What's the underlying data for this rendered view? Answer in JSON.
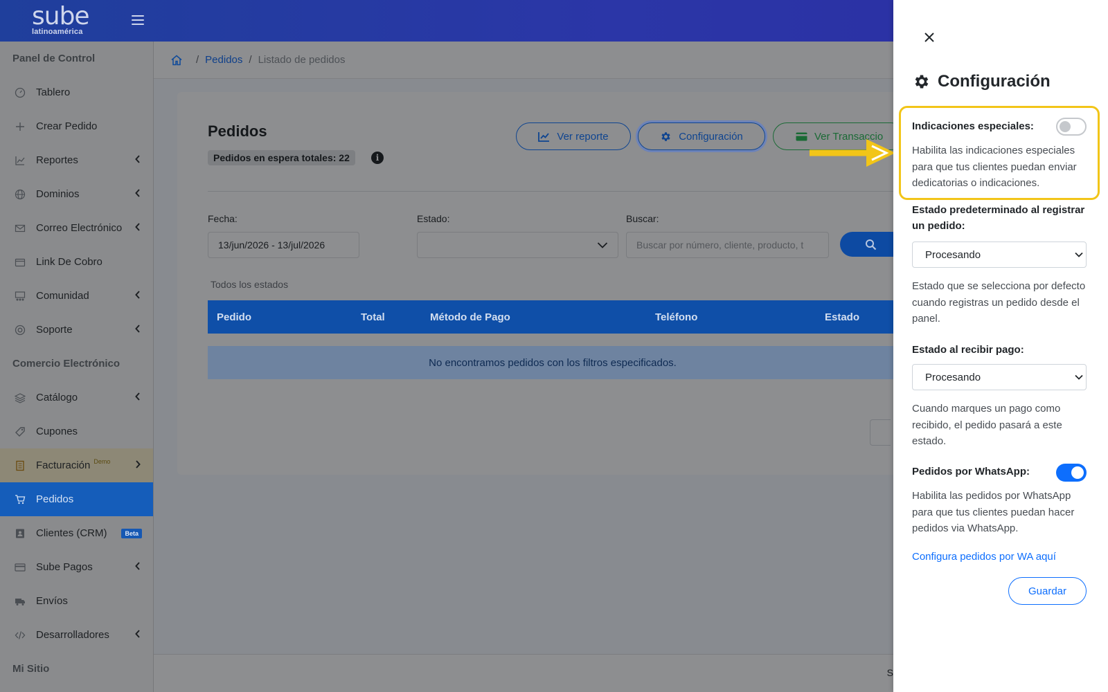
{
  "brand": {
    "logo_main": "sube",
    "logo_sub": "latinoamérica"
  },
  "colors": {
    "highlight": "#f2c518",
    "panel_accent": "#0d6efd",
    "active_nav": "#155dba"
  },
  "sidebar": {
    "sections": [
      {
        "title": "Panel de Control"
      },
      {
        "title": "Comercio Electrónico"
      },
      {
        "title": "Mi Sitio"
      }
    ],
    "control_items": [
      {
        "label": "Tablero",
        "icon": "gauge-icon",
        "has_submenu": false
      },
      {
        "label": "Crear Pedido",
        "icon": "plus-icon",
        "has_submenu": false
      },
      {
        "label": "Reportes",
        "icon": "chart-line-icon",
        "has_submenu": true
      },
      {
        "label": "Dominios",
        "icon": "globe-icon",
        "has_submenu": true
      },
      {
        "label": "Correo Electrónico",
        "icon": "envelope-icon",
        "has_submenu": true
      },
      {
        "label": "Link De Cobro",
        "icon": "wallet-icon",
        "has_submenu": false
      },
      {
        "label": "Comunidad",
        "icon": "community-icon",
        "has_submenu": true
      },
      {
        "label": "Soporte",
        "icon": "lifebuoy-icon",
        "has_submenu": true
      }
    ],
    "commerce_items": [
      {
        "label": "Catálogo",
        "icon": "layers-icon",
        "has_submenu": true
      },
      {
        "label": "Cupones",
        "icon": "tag-icon",
        "has_submenu": false
      },
      {
        "label": "Facturación",
        "sup": "Demo",
        "icon": "receipt-icon",
        "has_submenu": true
      },
      {
        "label": "Pedidos",
        "icon": "cart-icon",
        "active": true
      },
      {
        "label": "Clientes (CRM)",
        "badge": "Beta",
        "icon": "contact-icon"
      },
      {
        "label": "Sube Pagos",
        "icon": "card-icon",
        "has_submenu": true
      },
      {
        "label": "Envíos",
        "icon": "truck-icon",
        "has_submenu": false
      },
      {
        "label": "Desarrolladores",
        "icon": "code-icon",
        "has_submenu": true
      }
    ]
  },
  "breadcrumb": {
    "link": "Pedidos",
    "current": "Listado de pedidos",
    "separator": "/"
  },
  "orders": {
    "title": "Pedidos",
    "badge": "Pedidos en espera totales: 22",
    "buttons": {
      "report": "Ver reporte",
      "config": "Configuración",
      "transactions": "Ver Transaccio"
    },
    "filters": {
      "date_label": "Fecha:",
      "date_value": "13/jun/2026 - 13/jul/2026",
      "state_label": "Estado:",
      "state_value": "",
      "search_label": "Buscar:",
      "search_placeholder": "Buscar por número, cliente, producto, t"
    },
    "all_states": "Todos los estados",
    "columns": [
      "Pedido",
      "Total",
      "Método de Pago",
      "Teléfono",
      "Estado"
    ],
    "empty_message": "No encontramos pedidos con los filtros especificados."
  },
  "footer": {
    "text": "S"
  },
  "panel": {
    "title": "Configuración",
    "special": {
      "label": "Indicaciones especiales:",
      "enabled": false,
      "description": "Habilita las indicaciones especiales para que tus clientes puedan enviar dedicatorias o indicaciones."
    },
    "default_state": {
      "label": "Estado predeterminado al registrar un pedido:",
      "value": "Procesando",
      "description": "Estado que se selecciona por defecto cuando registras un pedido desde el panel."
    },
    "payment_state": {
      "label": "Estado al recibir pago:",
      "value": "Procesando",
      "description": "Cuando marques un pago como recibido, el pedido pasará a este estado."
    },
    "whatsapp": {
      "label": "Pedidos por WhatsApp:",
      "enabled": true,
      "description": "Habilita las pedidos por WhatsApp para que tus clientes puedan hacer pedidos via WhatsApp."
    },
    "link": "Configura pedidos por WA aquí",
    "save": "Guardar"
  }
}
